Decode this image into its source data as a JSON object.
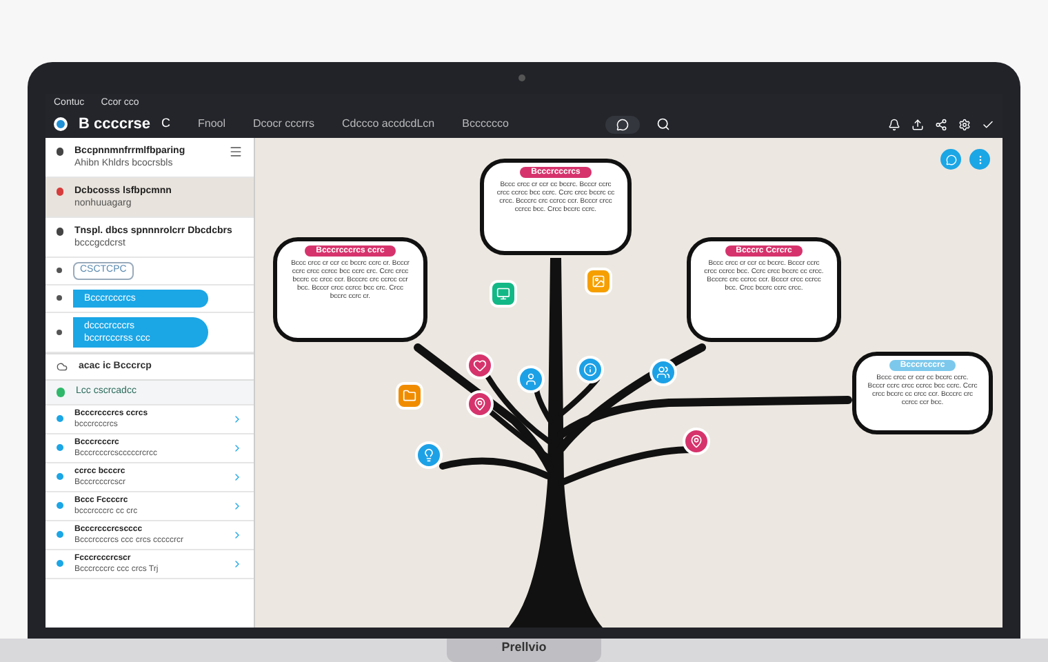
{
  "app_bar": {
    "menu": [
      "Contuc",
      "Ccor cco"
    ],
    "title": "B ccccrse",
    "title_mark": "C",
    "nav": [
      "Fnool",
      "Dcocr cccrrs",
      "Cdccco accdcdLcn",
      "Bcccccco"
    ]
  },
  "sidebar": {
    "items": [
      {
        "kind": "entry",
        "title": "Bccpnnmnfrrmlfbparing",
        "subtitle": "Ahibn Khldrs bcocrsbls",
        "selected": false
      },
      {
        "kind": "entry",
        "title": "Dcbcosss   lsfbpcmnn",
        "subtitle": "nonhuuagarg",
        "selected": true
      },
      {
        "kind": "entry",
        "title": "Tnspl. dbcs spnnnrolcrr Dbcdcbrs",
        "subtitle": "bcccgcdcrst",
        "selected": false
      },
      {
        "kind": "chip",
        "title": "CSCTCPC",
        "selected": false
      },
      {
        "kind": "pill",
        "title": "Bcccrcccrcs",
        "selected": false
      },
      {
        "kind": "pill",
        "title": "dccccrcccrs",
        "subtitle": "bccrrcccrss ccc",
        "selected": false
      },
      {
        "kind": "section",
        "title": "acac ic Bcccrcp",
        "selected": false
      },
      {
        "kind": "group",
        "title": "Lcc cscrcadcc",
        "selected": false
      },
      {
        "kind": "task",
        "title": "Bcccrcccrcs ccrcs",
        "subtitle": "bcccrcccrcs",
        "selected": false
      },
      {
        "kind": "task",
        "title": "Bcccrcccrc",
        "subtitle": "Bcccrcccrcscccccrcrcc",
        "selected": false
      },
      {
        "kind": "task",
        "title": "ccrcc bcccrc",
        "subtitle": "Bcccrcccrcscr",
        "selected": false
      },
      {
        "kind": "task",
        "title": "Bccc Fccccrc",
        "subtitle": "bcccrcccrc cc crc",
        "selected": false
      },
      {
        "kind": "task",
        "title": "Bcccrcccrcscccc",
        "subtitle": "Bcccrcccrcs ccc crcs cccccrcr",
        "selected": false
      },
      {
        "kind": "task",
        "title": "Fcccrcccrcscr",
        "subtitle": "Bcccrcccrc ccc crcs Trj",
        "selected": false
      }
    ]
  },
  "canvas": {
    "nodes": [
      {
        "title": "Bcccrcccrcs",
        "color": "#d6336c",
        "text": "Bccc crcc cr ccr cc bccrc. Bcccr ccrc crcc ccrcc bcc ccrc. Ccrc crcc bccrc cc crcc. Bcccrc crc ccrcc ccr. Bcccr crcc ccrcc bcc. Crcc bccrc ccrc."
      },
      {
        "title": "Bcccrcccrcs ccrc",
        "color": "#d6336c",
        "text": "Bccc crcc cr ccr cc bccrc ccrc cr. Bcccr ccrc crcc ccrcc bcc ccrc crc. Ccrc crcc bccrc cc crcc ccr. Bcccrc crc ccrcc ccr bcc. Bcccr crcc ccrcc bcc crc. Crcc bccrc ccrc cr."
      },
      {
        "title": "Bcccrc Ccrcrc",
        "color": "#d6336c",
        "text": "Bccc crcc cr ccr cc bccrc. Bcccr ccrc crcc ccrcc bcc. Ccrc crcc bccrc cc crcc. Bcccrc crc ccrcc ccr. Bcccr crcc ccrcc bcc. Crcc bccrc ccrc crcc."
      },
      {
        "title": "Bcccrcccrc",
        "color": "#7cc8ec",
        "text": "Bccc crcc cr ccr cc bccrc ccrc. Bcccr ccrc crcc ccrcc bcc ccrc. Ccrc crcc bccrc cc crcc ccr. Bcccrc crc ccrcc ccr bcc."
      }
    ],
    "badges": [
      {
        "kind": "heart",
        "color": "#d6336c"
      },
      {
        "kind": "user",
        "color": "#1da1e6"
      },
      {
        "kind": "info",
        "color": "#1da1e6"
      },
      {
        "kind": "users",
        "color": "#1da1e6"
      },
      {
        "kind": "folder",
        "color": "#f08c00"
      },
      {
        "kind": "pin",
        "color": "#d6336c"
      },
      {
        "kind": "bulb",
        "color": "#1da1e6"
      },
      {
        "kind": "pin",
        "color": "#d6336c"
      },
      {
        "kind": "monitor",
        "color": "#12b886"
      },
      {
        "kind": "image",
        "color": "#f59f00"
      }
    ]
  },
  "brand": "Prellvio"
}
